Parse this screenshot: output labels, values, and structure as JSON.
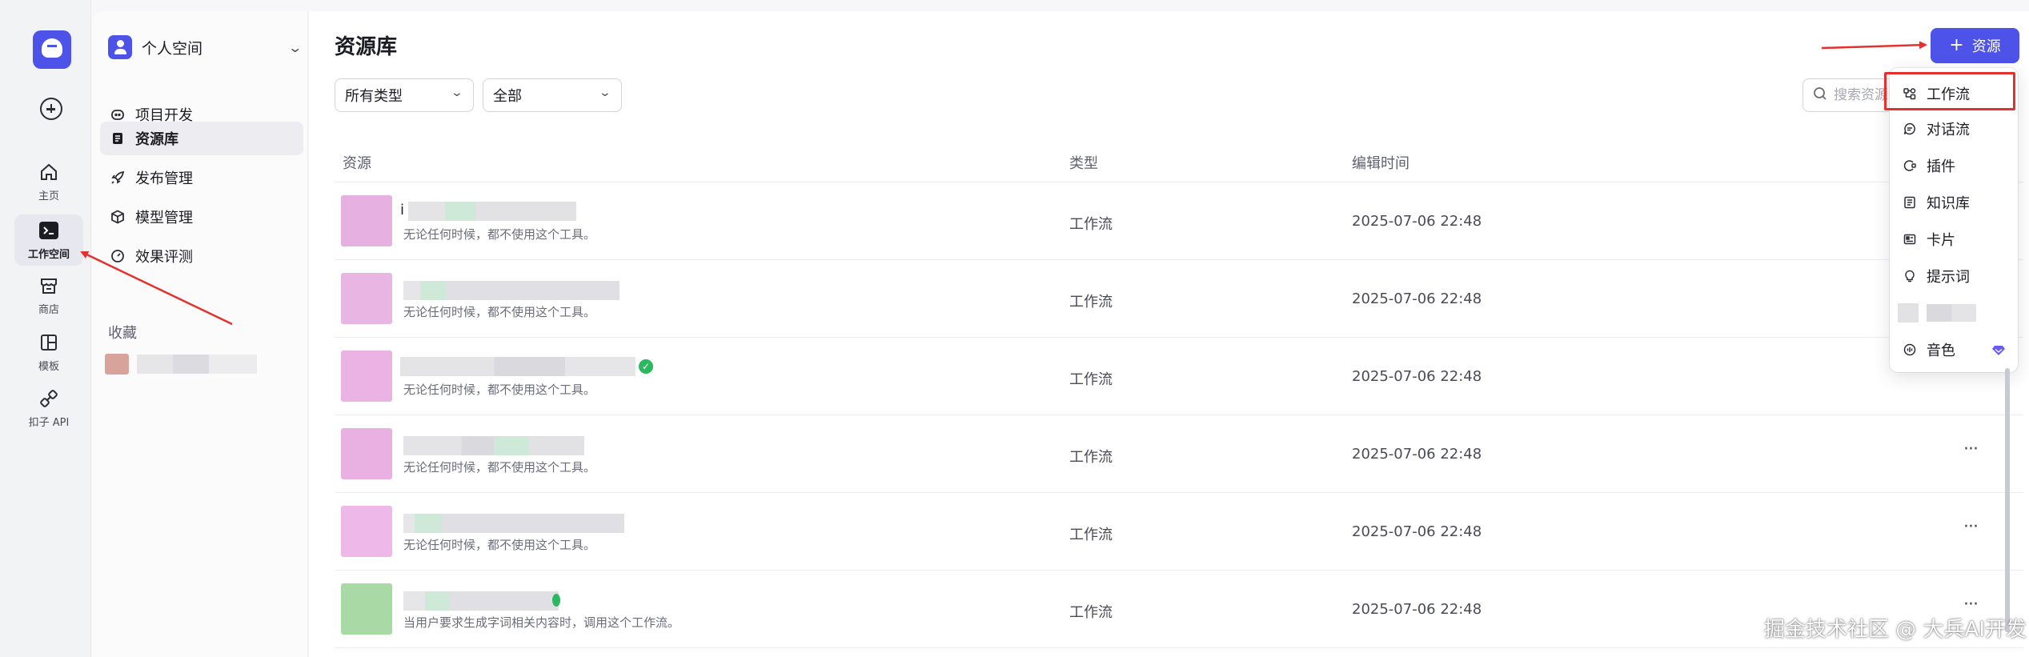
{
  "rail": {
    "items": [
      {
        "label": "主页",
        "icon": "home-icon"
      },
      {
        "label": "工作空间",
        "icon": "terminal-icon"
      },
      {
        "label": "商店",
        "icon": "store-icon"
      },
      {
        "label": "模板",
        "icon": "template-icon"
      },
      {
        "label": "扣子 API",
        "icon": "api-icon"
      }
    ]
  },
  "sidebar": {
    "space_name": "个人空间",
    "items": [
      {
        "label": "项目开发",
        "icon": "bot-icon"
      },
      {
        "label": "资源库",
        "icon": "library-icon"
      },
      {
        "label": "发布管理",
        "icon": "rocket-icon"
      },
      {
        "label": "模型管理",
        "icon": "cube-icon"
      },
      {
        "label": "效果评测",
        "icon": "gauge-icon"
      }
    ],
    "favorites_title": "收藏"
  },
  "main": {
    "title": "资源库",
    "filter_type": "所有类型",
    "filter_scope": "全部",
    "search_placeholder": "搜索资源",
    "add_button": "资源",
    "columns": [
      "资源",
      "类型",
      "编辑时间"
    ],
    "rows": [
      {
        "name_prefix": "i",
        "desc": "无论任何时候，都不使用这个工具。",
        "type": "工作流",
        "time": "2025-07-06 22:48"
      },
      {
        "name_prefix": "",
        "desc": "无论任何时候，都不使用这个工具。",
        "type": "工作流",
        "time": "2025-07-06 22:48"
      },
      {
        "name_prefix": "",
        "desc": "无论任何时候，都不使用这个工具。",
        "type": "工作流",
        "time": "2025-07-06 22:48"
      },
      {
        "name_prefix": "",
        "desc": "无论任何时候，都不使用这个工具。",
        "type": "工作流",
        "time": "2025-07-06 22:48"
      },
      {
        "name_prefix": "",
        "desc": "无论任何时候，都不使用这个工具。",
        "type": "工作流",
        "time": "2025-07-06 22:48"
      },
      {
        "name_prefix": "",
        "desc": "当用户要求生成字词相关内容时，调用这个工作流。",
        "type": "工作流",
        "time": "2025-07-06 22:48"
      }
    ],
    "more_label": "···"
  },
  "dropdown": {
    "items": [
      {
        "label": "工作流",
        "icon": "workflow-icon"
      },
      {
        "label": "对话流",
        "icon": "chatflow-icon"
      },
      {
        "label": "插件",
        "icon": "plugin-icon"
      },
      {
        "label": "知识库",
        "icon": "knowledge-icon"
      },
      {
        "label": "卡片",
        "icon": "card-icon"
      },
      {
        "label": "提示词",
        "icon": "prompt-icon"
      },
      {
        "label": "",
        "icon": "blurred-icon"
      },
      {
        "label": "音色",
        "icon": "voice-icon"
      }
    ]
  },
  "watermark": "掘金技术社区 @ 大兵AI开发",
  "colors": {
    "accent": "#4d53e8",
    "annotation": "#e3322d",
    "success": "#2bb85f"
  }
}
